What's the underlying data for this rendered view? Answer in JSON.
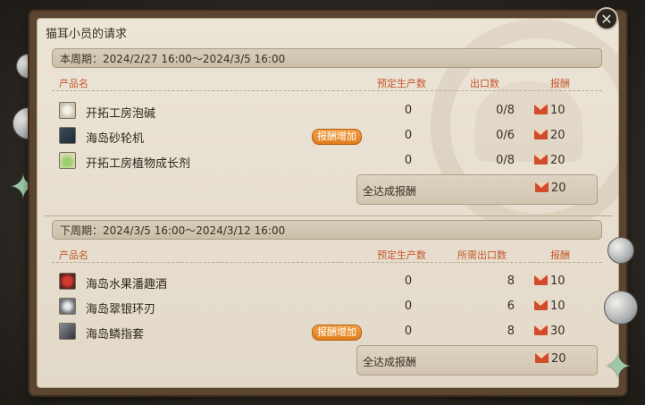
{
  "window": {
    "title": "猫耳小员的请求"
  },
  "columns": {
    "product": "产品名",
    "planned": "预定生产数",
    "export_current": "出口数",
    "export_next": "所需出口数",
    "reward": "报酬"
  },
  "current": {
    "period": "本周期：2024/2/27 16:00～2024/3/5 16:00",
    "items": [
      {
        "name": "开拓工房泡碱",
        "badge": "",
        "planned": "0",
        "export": "0/8",
        "reward": "10"
      },
      {
        "name": "海岛砂轮机",
        "badge": "报酬增加",
        "planned": "0",
        "export": "0/6",
        "reward": "20"
      },
      {
        "name": "开拓工房植物成长剂",
        "badge": "",
        "planned": "0",
        "export": "0/8",
        "reward": "20"
      }
    ],
    "total_label": "全达成报酬",
    "total_reward": "20"
  },
  "next": {
    "period": "下周期：2024/3/5 16:00～2024/3/12 16:00",
    "items": [
      {
        "name": "海岛水果潘趣酒",
        "badge": "",
        "planned": "0",
        "export": "8",
        "reward": "10"
      },
      {
        "name": "海岛翠银环刃",
        "badge": "",
        "planned": "0",
        "export": "6",
        "reward": "10"
      },
      {
        "name": "海岛鳞指套",
        "badge": "报酬增加",
        "planned": "0",
        "export": "8",
        "reward": "30"
      }
    ],
    "total_label": "全达成报酬",
    "total_reward": "20"
  },
  "icons": {
    "close": "close-icon",
    "reward": "envelope-icon",
    "item_icons": [
      "natron-icon",
      "grinder-icon",
      "plant-growth-icon",
      "fruit-punch-icon",
      "silver-ring-icon",
      "scale-fingerguard-icon"
    ]
  },
  "colors": {
    "header_text": "#c4582b",
    "badge": "#e8892a",
    "reward_envelope": "#d24b2a",
    "panel_bg": "#e6ddce",
    "frame": "#5c4530"
  }
}
